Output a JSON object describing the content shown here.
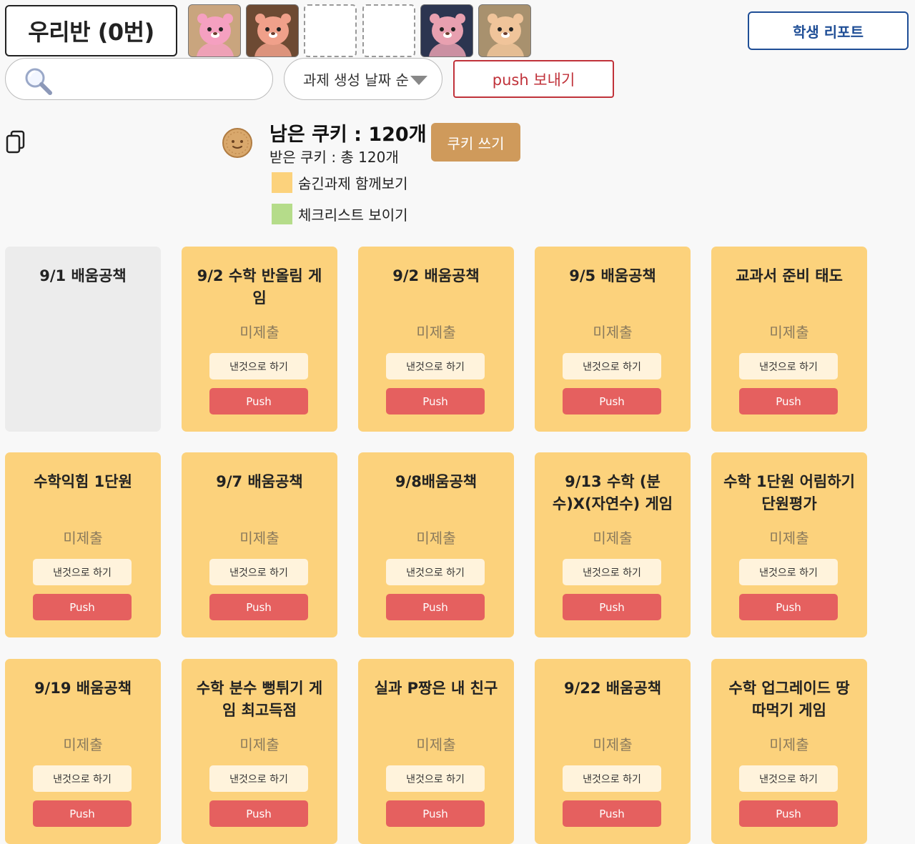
{
  "header": {
    "class_name": "우리반 (0번)",
    "report_label": "학생 리포트"
  },
  "avatars": [
    {
      "type": "character",
      "bg": "#c9a57e",
      "body": "#f5a0c0"
    },
    {
      "type": "character",
      "bg": "#6d4a33",
      "body": "#f0a08a"
    },
    {
      "type": "empty"
    },
    {
      "type": "empty"
    },
    {
      "type": "character",
      "bg": "#2c3550",
      "body": "#e8a0b0"
    },
    {
      "type": "character",
      "bg": "#a8916e",
      "body": "#f0c49a"
    }
  ],
  "toolbar": {
    "search_placeholder": "",
    "sort_label": "과제 생성 날짜 순",
    "push_send_label": "push 보내기"
  },
  "cookie": {
    "remaining": "남은 쿠키 : 120개",
    "received": "받은 쿠키 : 총 120개",
    "use_label": "쿠키 쓰기"
  },
  "options": [
    {
      "label": "숨긴과제 함께보기",
      "color": "#fcd27c"
    },
    {
      "label": "체크리스트 보이기",
      "color": "#b5dc8a"
    }
  ],
  "card_labels": {
    "status": "미제출",
    "submit": "낸것으로 하기",
    "push": "Push"
  },
  "cards": [
    {
      "title": "9/1 배움공책",
      "variant": "gray"
    },
    {
      "title": "9/2 수학 반올림 게임",
      "variant": "normal"
    },
    {
      "title": "9/2 배움공책",
      "variant": "normal"
    },
    {
      "title": "9/5 배움공책",
      "variant": "normal"
    },
    {
      "title": "교과서 준비 태도",
      "variant": "normal"
    },
    {
      "title": "수학익힘 1단원",
      "variant": "normal"
    },
    {
      "title": "9/7 배움공책",
      "variant": "normal"
    },
    {
      "title": "9/8배움공책",
      "variant": "normal"
    },
    {
      "title": "9/13 수학 (분수)X(자연수) 게임",
      "variant": "normal"
    },
    {
      "title": "수학 1단원 어림하기 단원평가",
      "variant": "normal"
    },
    {
      "title": "9/19 배움공책",
      "variant": "normal"
    },
    {
      "title": "수학 분수 뻥튀기 게임 최고득점",
      "variant": "normal"
    },
    {
      "title": "실과 P짱은 내 친구",
      "variant": "normal"
    },
    {
      "title": "9/22 배움공책",
      "variant": "normal"
    },
    {
      "title": "수학 업그레이드 땅따먹기 게임",
      "variant": "normal"
    }
  ],
  "colors": {
    "card": "#fcd27c",
    "card_disabled": "#ececec",
    "push_button": "#e5605f",
    "report_border": "#1f4e96",
    "push_send_border": "#c0323a",
    "cookie_button": "#cf9a5b"
  }
}
